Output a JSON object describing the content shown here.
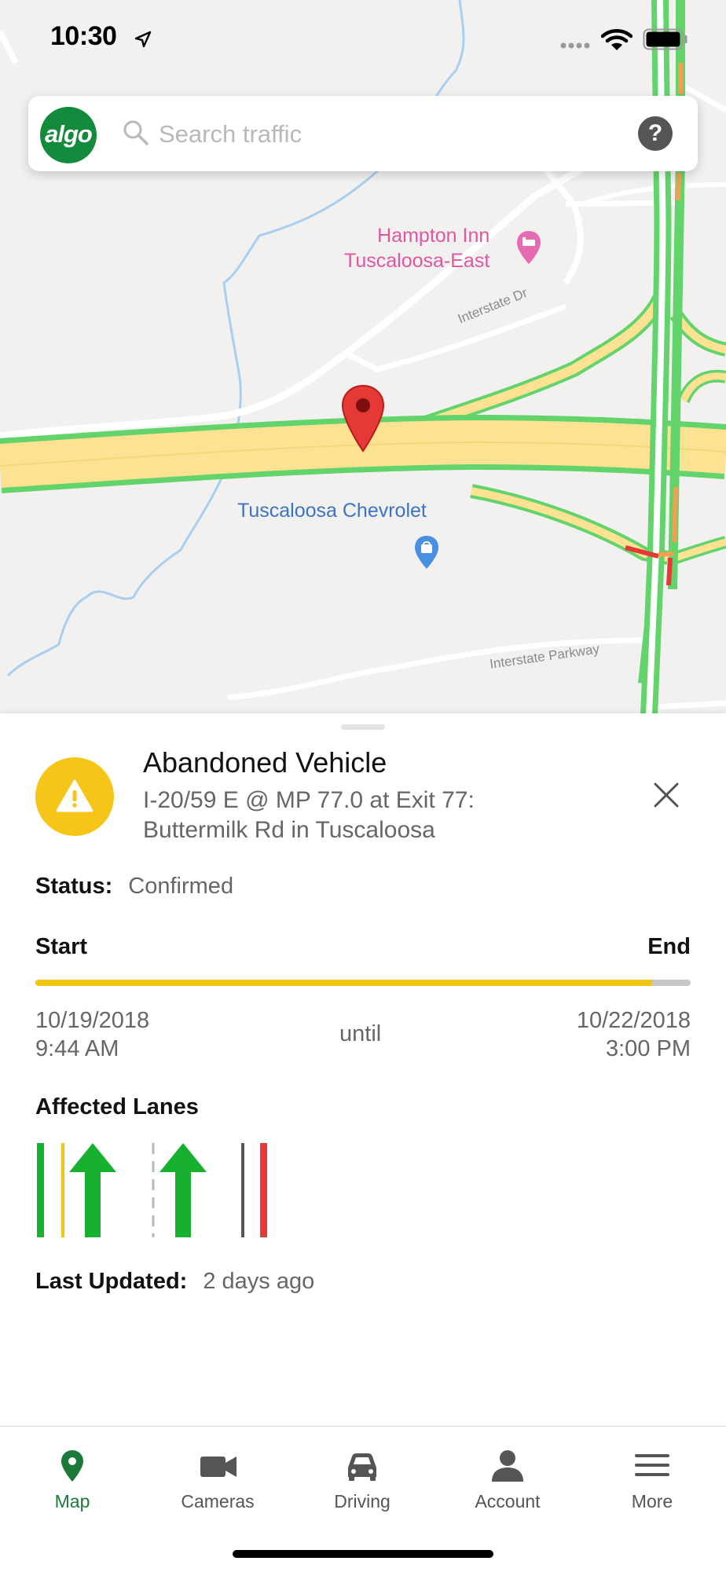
{
  "status_bar": {
    "time": "10:30",
    "location_icon": "location-arrow-icon",
    "signal_icon": "cell-signal-icon",
    "wifi_icon": "wifi-icon",
    "battery_icon": "battery-icon"
  },
  "search": {
    "logo_text": "algo",
    "placeholder": "Search traffic",
    "help_label": "?"
  },
  "map": {
    "labels": {
      "hotel": "Hampton Inn\nTuscaloosa-East",
      "dealer": "Tuscaloosa Chevrolet",
      "road_1": "Interstate Dr",
      "road_2": "Interstate Parkway"
    },
    "colors": {
      "free_flow": "#63d46b",
      "highway_fill": "#fde293",
      "slow": "#f0a050",
      "congested": "#e53935",
      "hotel_pin": "#e66bb0",
      "store_pin": "#4a90e2",
      "incident_pin": "#e53935"
    }
  },
  "incident": {
    "icon": "warning-icon",
    "title": "Abandoned Vehicle",
    "location": "I-20/59 E @ MP 77.0 at Exit 77: Buttermilk Rd in Tuscaloosa",
    "status_label": "Status:",
    "status_value": "Confirmed",
    "start_label": "Start",
    "end_label": "End",
    "progress": 0.94,
    "start_date": "10/19/2018",
    "start_time": "9:44 AM",
    "until": "until",
    "end_date": "10/22/2018",
    "end_time": "3:00 PM",
    "lanes_title": "Affected Lanes",
    "lanes": [
      {
        "type": "shoulder",
        "color": "#17b02f",
        "status": "open"
      },
      {
        "type": "lane",
        "direction": "up-arrow",
        "status": "open"
      },
      {
        "type": "lane",
        "direction": "up-arrow",
        "status": "open"
      },
      {
        "type": "shoulder",
        "color": "#e53935",
        "status": "closed"
      }
    ],
    "updated_label": "Last Updated:",
    "updated_value": "2 days ago",
    "colors": {
      "accent": "#f5c518",
      "progress": "#f2c511",
      "lane_open": "#17b02f",
      "lane_closed": "#e53935"
    }
  },
  "tabs": [
    {
      "label": "Map",
      "icon": "map-pin-icon",
      "active": true
    },
    {
      "label": "Cameras",
      "icon": "video-camera-icon",
      "active": false
    },
    {
      "label": "Driving",
      "icon": "car-icon",
      "active": false
    },
    {
      "label": "Account",
      "icon": "user-icon",
      "active": false
    },
    {
      "label": "More",
      "icon": "menu-icon",
      "active": false
    }
  ]
}
